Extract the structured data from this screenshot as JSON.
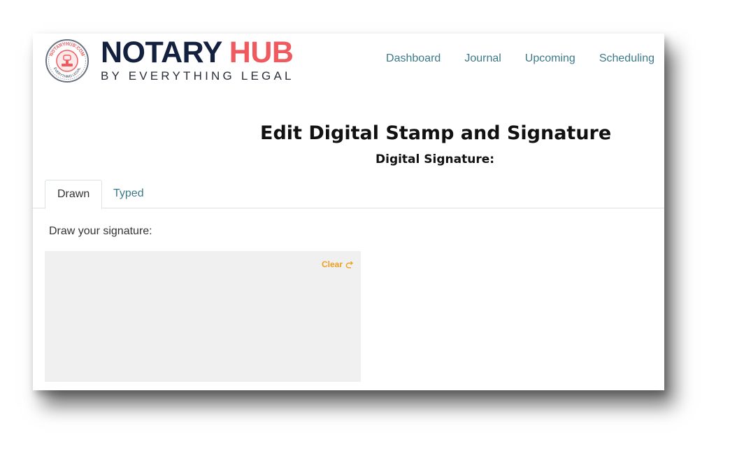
{
  "brand": {
    "name_part1": "NOTARY",
    "name_part2": "HUB",
    "tagline": "BY EVERYTHING LEGAL",
    "seal_text_top": "NOTARYHUB.COM",
    "seal_text_bottom": "EVERYTHING LEGAL",
    "colors": {
      "navy": "#13213f",
      "coral": "#ef5a5f"
    }
  },
  "nav": {
    "items": [
      {
        "label": "Dashboard"
      },
      {
        "label": "Journal"
      },
      {
        "label": "Upcoming"
      },
      {
        "label": "Scheduling"
      }
    ],
    "color": "#3c7a8b"
  },
  "page": {
    "title": "Edit Digital Stamp and Signature",
    "section_title": "Digital Signature:"
  },
  "tabs": [
    {
      "label": "Drawn",
      "active": true
    },
    {
      "label": "Typed",
      "active": false
    }
  ],
  "signature": {
    "prompt": "Draw your signature:",
    "clear_label": "Clear",
    "clear_icon": "redo-arrow-icon",
    "accent_color": "#f0a020"
  }
}
